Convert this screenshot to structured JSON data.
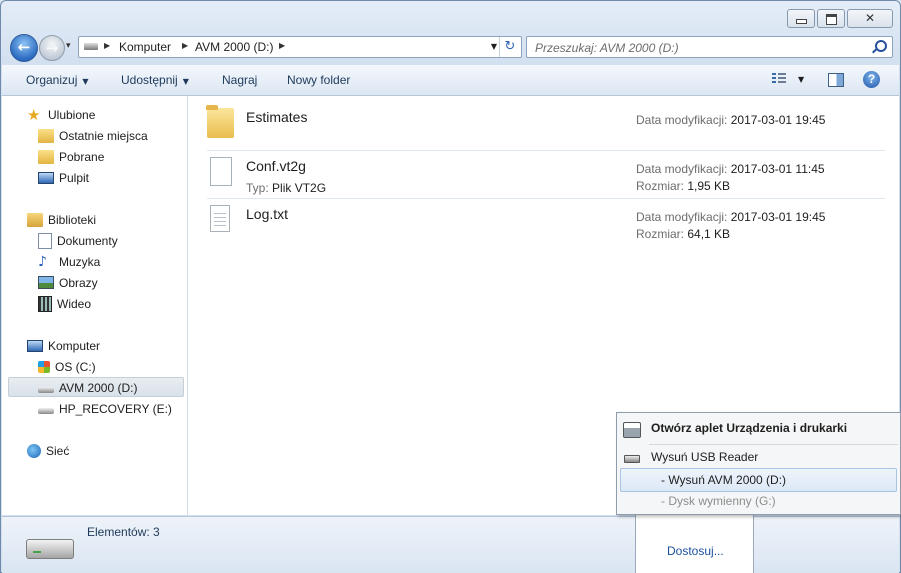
{
  "window": {
    "minimize_glyph": "",
    "close_glyph": "✕"
  },
  "nav": {
    "back_arrow": "←",
    "forward_arrow": "→",
    "history_dropdown": "▾"
  },
  "address": {
    "crumbs": [
      "Komputer",
      "AVM 2000 (D:)"
    ],
    "separator": "▶",
    "dropdown": "▼",
    "refresh_glyph": "↻"
  },
  "search": {
    "placeholder": "Przeszukaj: AVM 2000 (D:)"
  },
  "toolbar": {
    "organize": "Organizuj",
    "share": "Udostępnij",
    "burn": "Nagraj",
    "new_folder": "Nowy folder",
    "help": "?"
  },
  "sidebar": {
    "favorites": {
      "label": "Ulubione",
      "items": [
        "Ostatnie miejsca",
        "Pobrane",
        "Pulpit"
      ]
    },
    "libraries": {
      "label": "Biblioteki",
      "items": [
        "Dokumenty",
        "Muzyka",
        "Obrazy",
        "Wideo"
      ]
    },
    "computer": {
      "label": "Komputer",
      "items": [
        "OS (C:)",
        "AVM 2000 (D:)",
        "HP_RECOVERY (E:)"
      ]
    },
    "network": {
      "label": "Sieć"
    }
  },
  "files": [
    {
      "name": "Estimates",
      "icon": "folder-icon",
      "modified_label": "Data modyfikacji:",
      "modified": "2017-03-01 19:45"
    },
    {
      "name": "Conf.vt2g",
      "icon": "file-icon",
      "type_label": "Typ:",
      "type": "Plik VT2G",
      "modified_label": "Data modyfikacji:",
      "modified": "2017-03-01 11:45",
      "size_label": "Rozmiar:",
      "size": "1,95 KB"
    },
    {
      "name": "Log.txt",
      "icon": "text-file-icon",
      "modified_label": "Data modyfikacji:",
      "modified": "2017-03-01 19:45",
      "size_label": "Rozmiar:",
      "size": "64,1 KB"
    }
  ],
  "details": {
    "count": "Elementów: 3"
  },
  "tray": {
    "customize": "Dostosuj..."
  },
  "context_menu": {
    "open_devices": "Otwórz aplet Urządzenia i drukarki",
    "eject_usb": "Wysuń USB Reader",
    "eject_avm": "-   Wysuń AVM 2000 (D:)",
    "removable": "-   Dysk wymienny (G:)"
  },
  "colors": {
    "accent": "#1e395b",
    "link": "#1a4f9c",
    "folder": "#e9bd4f"
  }
}
